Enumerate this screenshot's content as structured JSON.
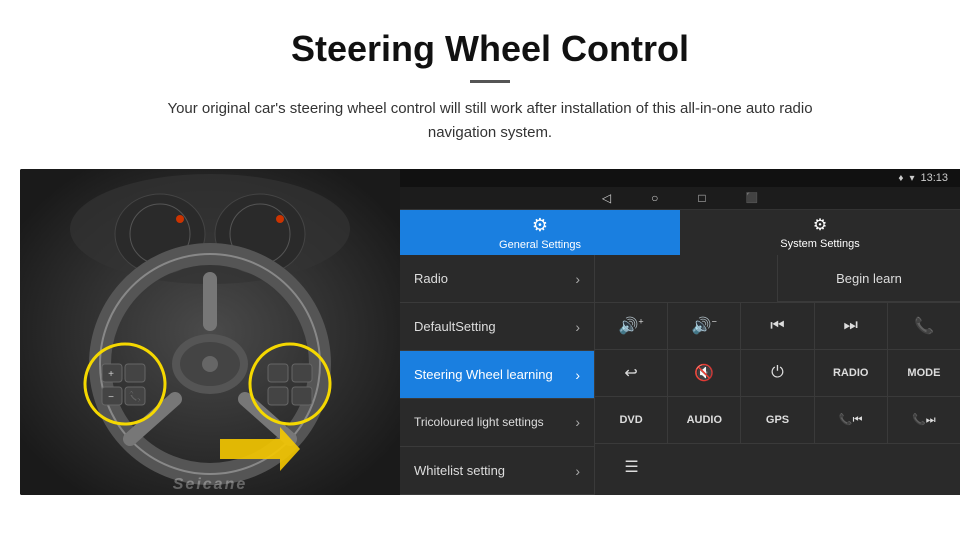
{
  "header": {
    "title": "Steering Wheel Control",
    "divider": true,
    "subtitle": "Your original car's steering wheel control will still work after installation of this all-in-one auto radio navigation system."
  },
  "statusbar": {
    "time": "13:13",
    "signal_icon": "♦",
    "wifi_icon": "▾",
    "nav_back": "◁",
    "nav_home": "○",
    "nav_square": "□",
    "nav_extra": "⬜"
  },
  "tabs": {
    "general": {
      "label": "General Settings",
      "icon": "⚙"
    },
    "system": {
      "label": "System Settings",
      "icon": "⚙"
    }
  },
  "menu": {
    "items": [
      {
        "label": "Radio",
        "active": false
      },
      {
        "label": "DefaultSetting",
        "active": false
      },
      {
        "label": "Steering Wheel learning",
        "active": true
      },
      {
        "label": "Tricoloured light settings",
        "active": false
      },
      {
        "label": "Whitelist setting",
        "active": false
      }
    ]
  },
  "panel": {
    "begin_learn_label": "Begin learn",
    "button_rows": [
      [
        {
          "type": "icon",
          "content": "🔊+",
          "label": "vol-up"
        },
        {
          "type": "icon",
          "content": "🔊−",
          "label": "vol-down"
        },
        {
          "type": "icon",
          "content": "⏮",
          "label": "prev"
        },
        {
          "type": "icon",
          "content": "⏭",
          "label": "next"
        },
        {
          "type": "icon",
          "content": "📞",
          "label": "phone"
        }
      ],
      [
        {
          "type": "icon",
          "content": "↩",
          "label": "back-call"
        },
        {
          "type": "icon",
          "content": "🔇",
          "label": "mute"
        },
        {
          "type": "icon",
          "content": "⏻",
          "label": "power"
        },
        {
          "type": "text",
          "content": "RADIO",
          "label": "radio"
        },
        {
          "type": "text",
          "content": "MODE",
          "label": "mode"
        }
      ],
      [
        {
          "type": "text",
          "content": "DVD",
          "label": "dvd"
        },
        {
          "type": "text",
          "content": "AUDIO",
          "label": "audio"
        },
        {
          "type": "text",
          "content": "GPS",
          "label": "gps"
        },
        {
          "type": "icon",
          "content": "📞⏮",
          "label": "phone-prev"
        },
        {
          "type": "icon",
          "content": "📞⏭",
          "label": "phone-next"
        }
      ],
      [
        {
          "type": "icon",
          "content": "≡",
          "label": "menu-icon"
        }
      ]
    ]
  },
  "watermark": "Seicane"
}
